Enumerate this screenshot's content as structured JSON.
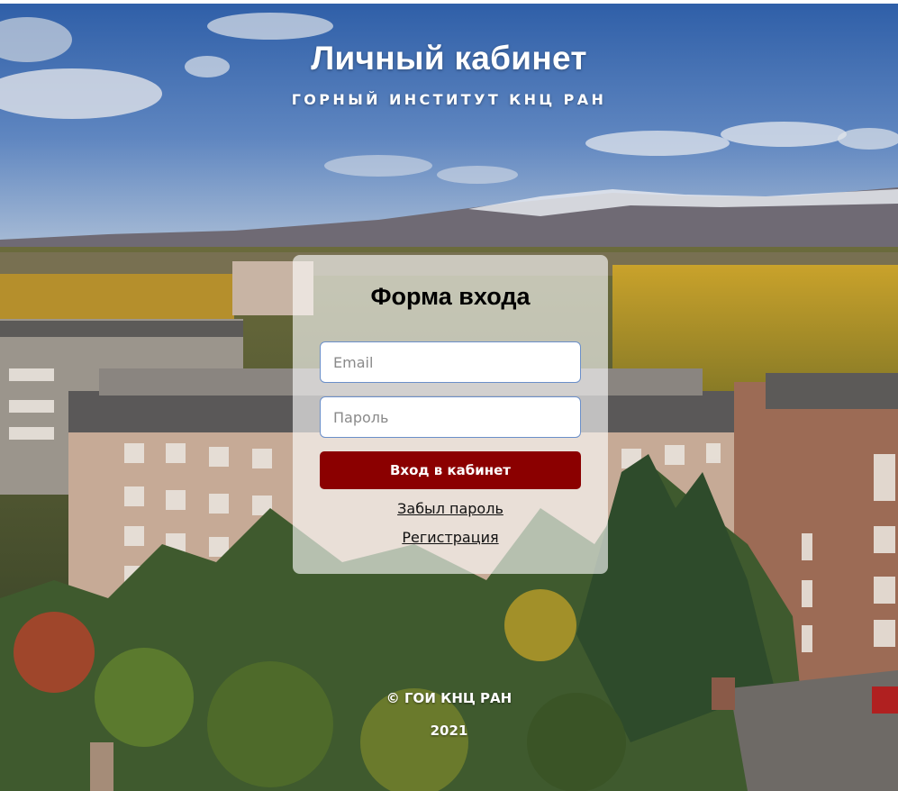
{
  "header": {
    "title": "Личный кабинет",
    "subtitle": "ГОРНЫЙ ИНСТИТУТ КНЦ РАН"
  },
  "login_form": {
    "title": "Форма входа",
    "email_placeholder": "Email",
    "password_placeholder": "Пароль",
    "submit_label": "Вход в кабинет",
    "forgot_password_label": "Забыл пароль",
    "register_label": "Регистрация"
  },
  "footer": {
    "copyright": "© ГОИ КНЦ РАН",
    "year": "2021"
  },
  "colors": {
    "accent_button": "#8b0000",
    "input_border": "#6b8fc9",
    "card_background": "rgba(255,255,255,0.62)"
  }
}
